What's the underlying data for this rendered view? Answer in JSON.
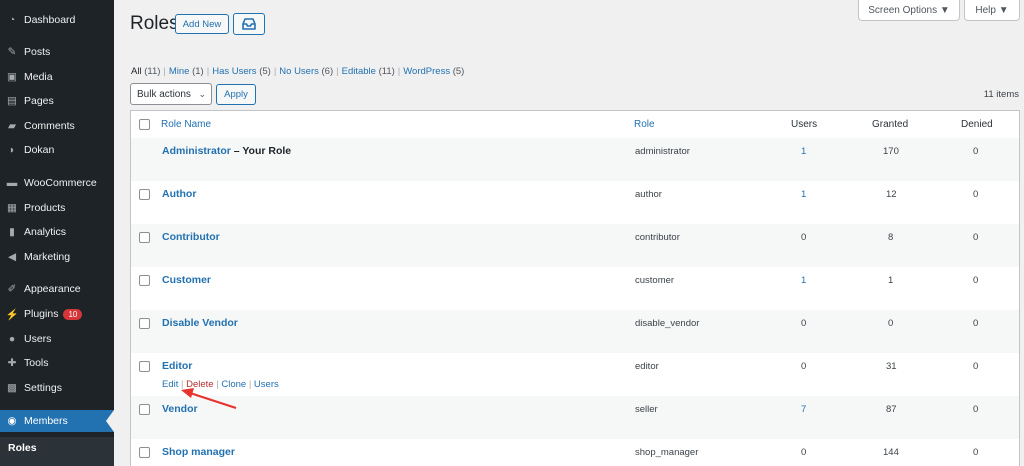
{
  "sidebar": {
    "items": [
      {
        "label": "Dashboard",
        "icon": "dashboard-icon"
      },
      {
        "label": "Posts",
        "icon": "pin-icon"
      },
      {
        "label": "Media",
        "icon": "media-icon"
      },
      {
        "label": "Pages",
        "icon": "pages-icon"
      },
      {
        "label": "Comments",
        "icon": "comments-icon"
      },
      {
        "label": "Dokan",
        "icon": "dokan-icon"
      },
      {
        "label": "WooCommerce",
        "icon": "woocommerce-icon"
      },
      {
        "label": "Products",
        "icon": "products-icon"
      },
      {
        "label": "Analytics",
        "icon": "analytics-icon"
      },
      {
        "label": "Marketing",
        "icon": "megaphone-icon"
      },
      {
        "label": "Appearance",
        "icon": "brush-icon"
      },
      {
        "label": "Plugins",
        "icon": "plugin-icon",
        "badge": "10"
      },
      {
        "label": "Users",
        "icon": "users-icon"
      },
      {
        "label": "Tools",
        "icon": "wrench-icon"
      },
      {
        "label": "Settings",
        "icon": "settings-icon"
      },
      {
        "label": "Members",
        "icon": "members-icon",
        "active": true
      }
    ],
    "submenu": {
      "current": "Roles"
    }
  },
  "header": {
    "title": "Roles",
    "add_new_label": "Add New",
    "screen_options_label": "Screen Options ▼",
    "help_label": "Help ▼"
  },
  "filters": [
    {
      "label": "All",
      "count": "(11)",
      "current": true
    },
    {
      "label": "Mine",
      "count": "(1)"
    },
    {
      "label": "Has Users",
      "count": "(5)"
    },
    {
      "label": "No Users",
      "count": "(6)"
    },
    {
      "label": "Editable",
      "count": "(11)"
    },
    {
      "label": "WordPress",
      "count": "(5)"
    }
  ],
  "bulk": {
    "selected": "Bulk actions",
    "apply_label": "Apply"
  },
  "items_count": "11 items",
  "table": {
    "columns": {
      "role_name": "Role Name",
      "role": "Role",
      "users": "Users",
      "granted": "Granted",
      "denied": "Denied"
    },
    "rows": [
      {
        "name": "Administrator",
        "suffix": " – Your Role",
        "role": "administrator",
        "users": "1",
        "users_link": true,
        "granted": "170",
        "denied": "0",
        "checkbox": false
      },
      {
        "name": "Author",
        "role": "author",
        "users": "1",
        "users_link": true,
        "granted": "12",
        "denied": "0",
        "checkbox": true
      },
      {
        "name": "Contributor",
        "role": "contributor",
        "users": "0",
        "granted": "8",
        "denied": "0",
        "checkbox": true
      },
      {
        "name": "Customer",
        "role": "customer",
        "users": "1",
        "users_link": true,
        "granted": "1",
        "denied": "0",
        "checkbox": true
      },
      {
        "name": "Disable Vendor",
        "role": "disable_vendor",
        "users": "0",
        "granted": "0",
        "denied": "0",
        "checkbox": true
      },
      {
        "name": "Editor",
        "role": "editor",
        "users": "0",
        "granted": "31",
        "denied": "0",
        "checkbox": true,
        "actions": {
          "edit": "Edit",
          "delete": "Delete",
          "clone": "Clone",
          "users": "Users",
          "sep": "|"
        }
      },
      {
        "name": "Vendor",
        "role": "seller",
        "users": "7",
        "users_link": true,
        "granted": "87",
        "denied": "0",
        "checkbox": true
      },
      {
        "name": "Shop manager",
        "role": "shop_manager",
        "users": "0",
        "granted": "144",
        "denied": "0",
        "checkbox": true
      }
    ]
  },
  "colors": {
    "accent": "#2271b1",
    "sidebar_bg": "#1d2327",
    "delete": "#b32d2e",
    "annotation_arrow": "#e8322b"
  }
}
